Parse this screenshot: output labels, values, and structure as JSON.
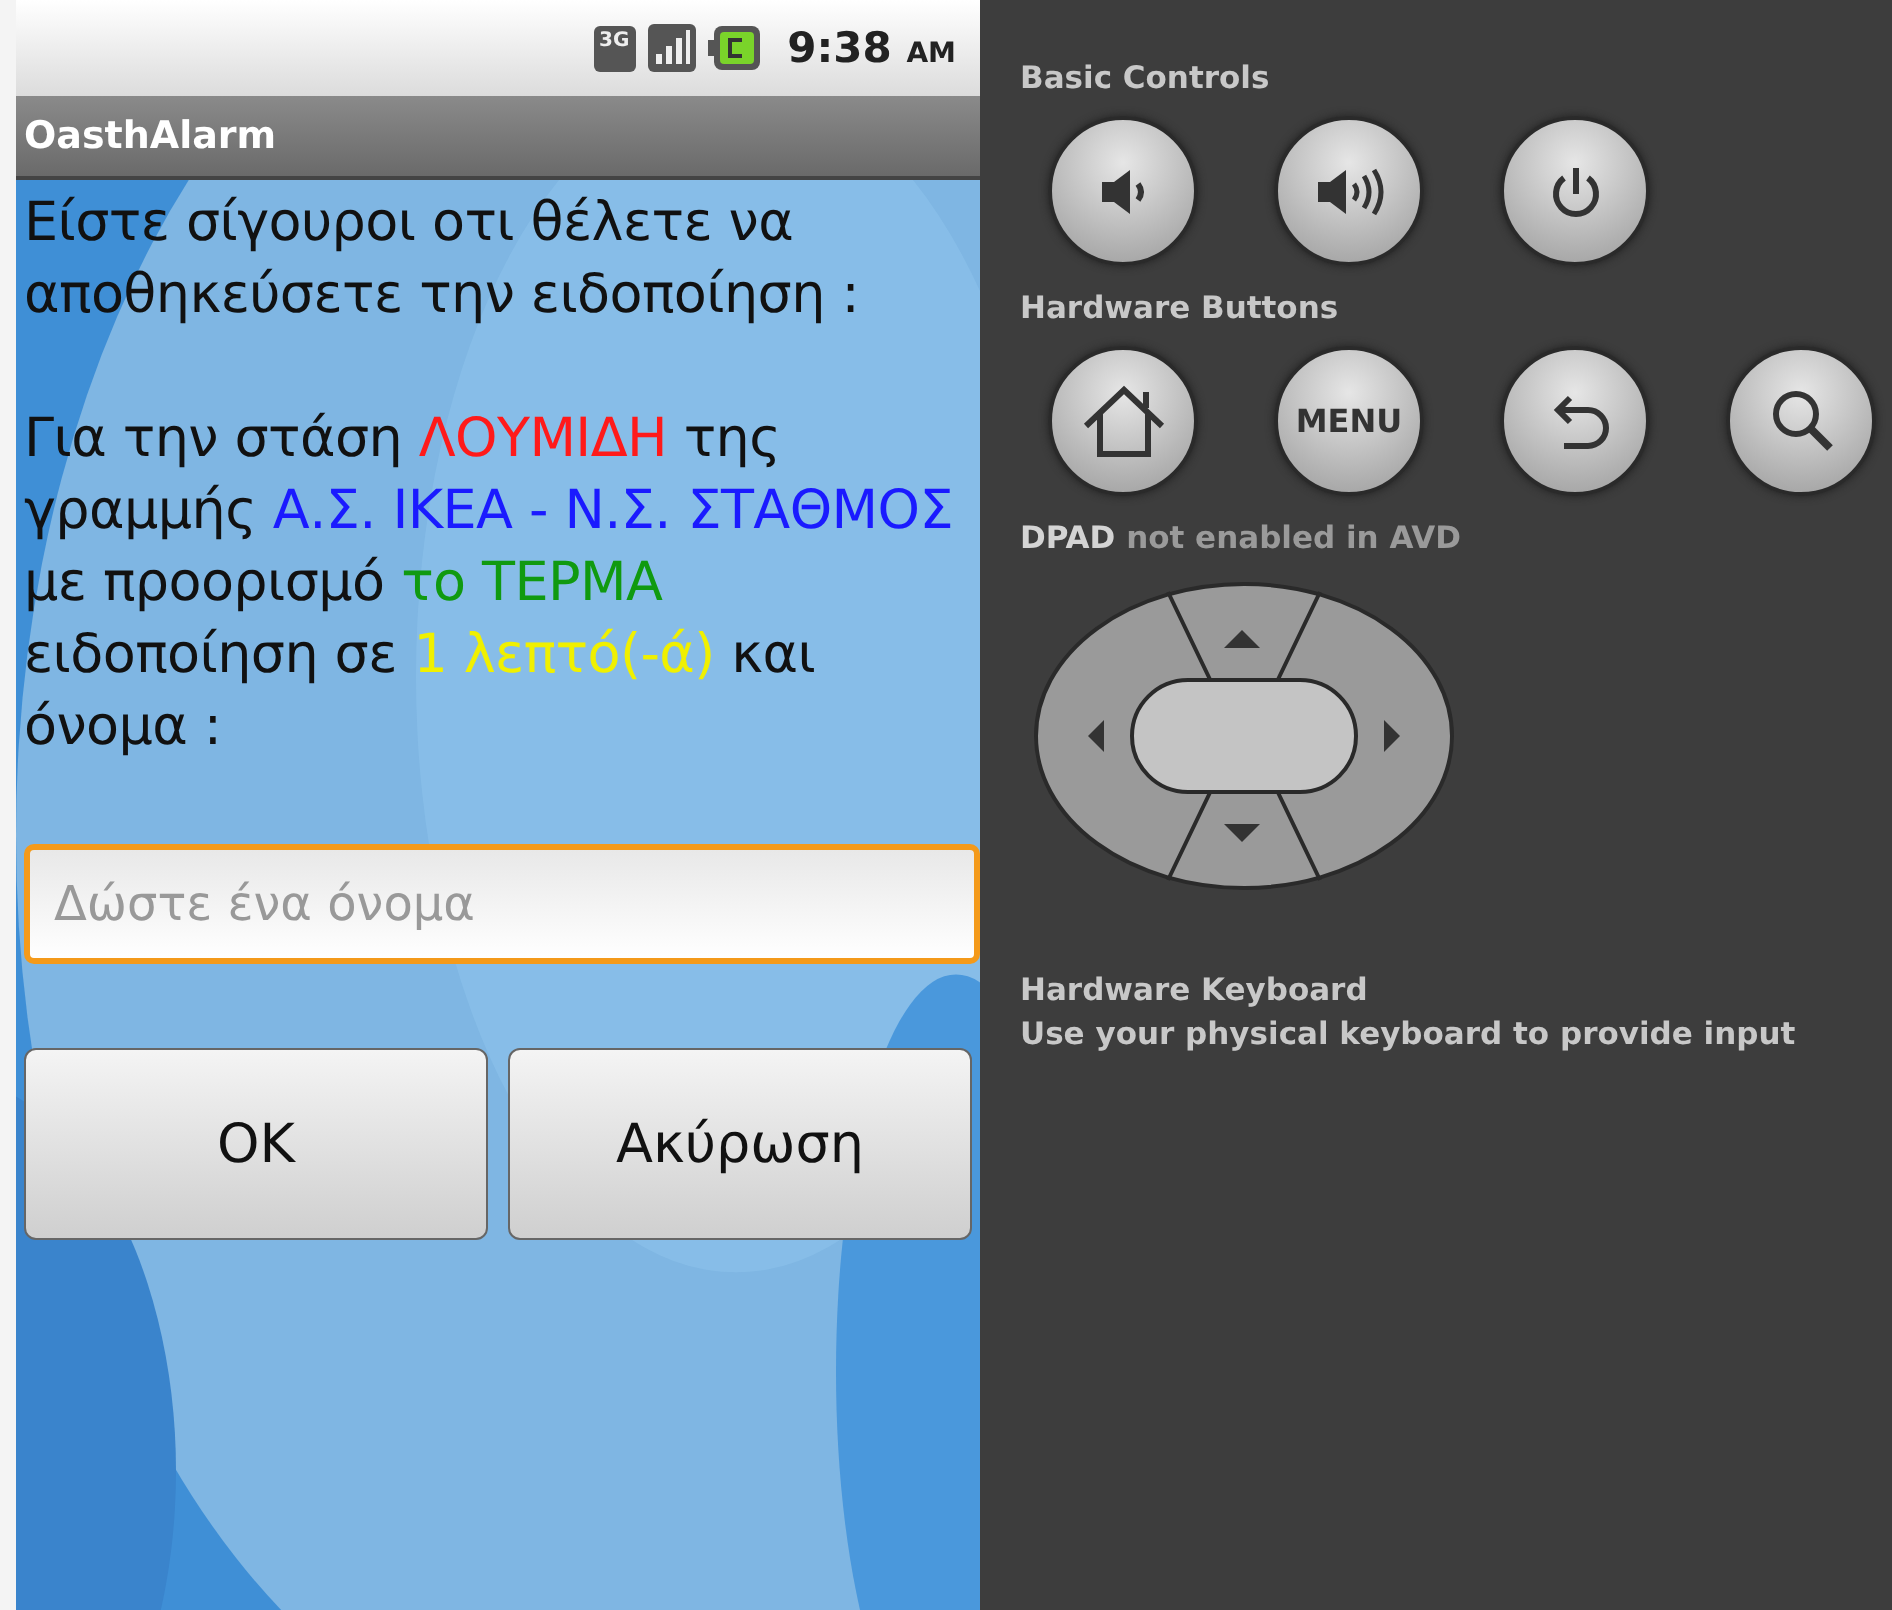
{
  "status_bar": {
    "network": "3G",
    "time": "9:38",
    "meridiem": "AM"
  },
  "app": {
    "title": "OasthAlarm",
    "prompt": "Είστε σίγουροι οτι θέλετε να αποθηκεύσετε την ειδοποίηση :",
    "details": [
      {
        "text": "Για την στάση "
      },
      {
        "text": "ΛΟΥΜΙΔΗ",
        "color": "#ff1a1a"
      },
      {
        "text": " της γραμμής "
      },
      {
        "text": "Α.Σ. ΙΚΕΑ - Ν.Σ. ΣΤΑΘΜΟΣ",
        "color": "#1a1aff"
      },
      {
        "text": " με προορισμό "
      },
      {
        "text": "το ΤΕΡΜΑ",
        "color": "#109a10"
      },
      {
        "text": " ειδοποίηση σε "
      },
      {
        "text": "1 λεπτό(-ά)",
        "color": "#f0f000"
      },
      {
        "text": " και όνομα :"
      }
    ],
    "name_field": {
      "placeholder": "Δώστε ένα όνομα",
      "focused": true
    },
    "buttons": [
      "OK",
      "Ακύρωση"
    ]
  },
  "controls": {
    "basic_title": "Basic Controls",
    "basic": [
      {
        "kind": "volume-down"
      },
      {
        "kind": "volume-up"
      },
      {
        "kind": "power"
      }
    ],
    "hardware_title": "Hardware Buttons",
    "hardware": [
      {
        "kind": "home"
      },
      {
        "kind": "menu",
        "label": "MENU"
      },
      {
        "kind": "back"
      },
      {
        "kind": "search"
      }
    ],
    "dpad_note": [
      {
        "text": "DPAD",
        "highlighted": true
      },
      {
        "text": " not enabled in AVD",
        "highlighted": false
      }
    ],
    "keyboard_title": "Hardware Keyboard",
    "keyboard_note": "Use your physical keyboard to provide input"
  }
}
